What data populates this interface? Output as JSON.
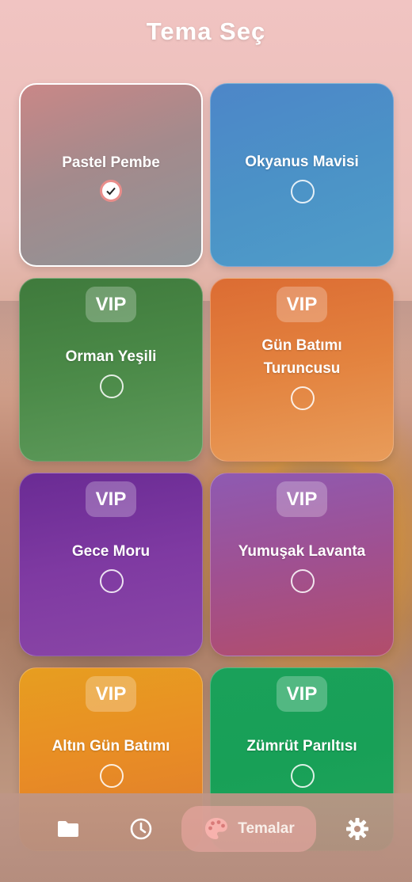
{
  "header": {
    "title": "Tema Seç"
  },
  "themes": [
    {
      "name": "Pastel Pembe",
      "vip": "",
      "selected": true
    },
    {
      "name": "Okyanus Mavisi",
      "vip": "",
      "selected": false
    },
    {
      "name": "Orman Yeşili",
      "vip": "VIP",
      "selected": false
    },
    {
      "name_line1": "Gün Batımı",
      "name_line2": "Turuncusu",
      "vip": "VIP",
      "selected": false
    },
    {
      "name": "Gece Moru",
      "vip": "VIP",
      "selected": false
    },
    {
      "name": "Yumuşak Lavanta",
      "vip": "VIP",
      "selected": false
    },
    {
      "name": "Altın Gün Batımı",
      "vip": "VIP",
      "selected": false
    },
    {
      "name": "Zümrüt Parıltısı",
      "vip": "VIP",
      "selected": false
    }
  ],
  "nav": {
    "items": [
      {
        "icon": "folder-icon"
      },
      {
        "icon": "clock-icon"
      },
      {
        "icon": "palette-icon",
        "label": "Temalar",
        "active": true
      },
      {
        "icon": "gear-icon"
      }
    ]
  },
  "colors": {
    "accent": "#e98d8a",
    "pastel_pembe": "#a48a8c",
    "okyanus_mavisi": "#4b92c7",
    "orman_yesili": "#4b8a48",
    "gun_batimi_turuncusu": "#e3833f",
    "gece_moru": "#7f3aa2",
    "yumusak_lavanta": "#a05090",
    "altin_gun_batimi": "#e88c25",
    "zumrut_paritisi": "#18a057"
  }
}
